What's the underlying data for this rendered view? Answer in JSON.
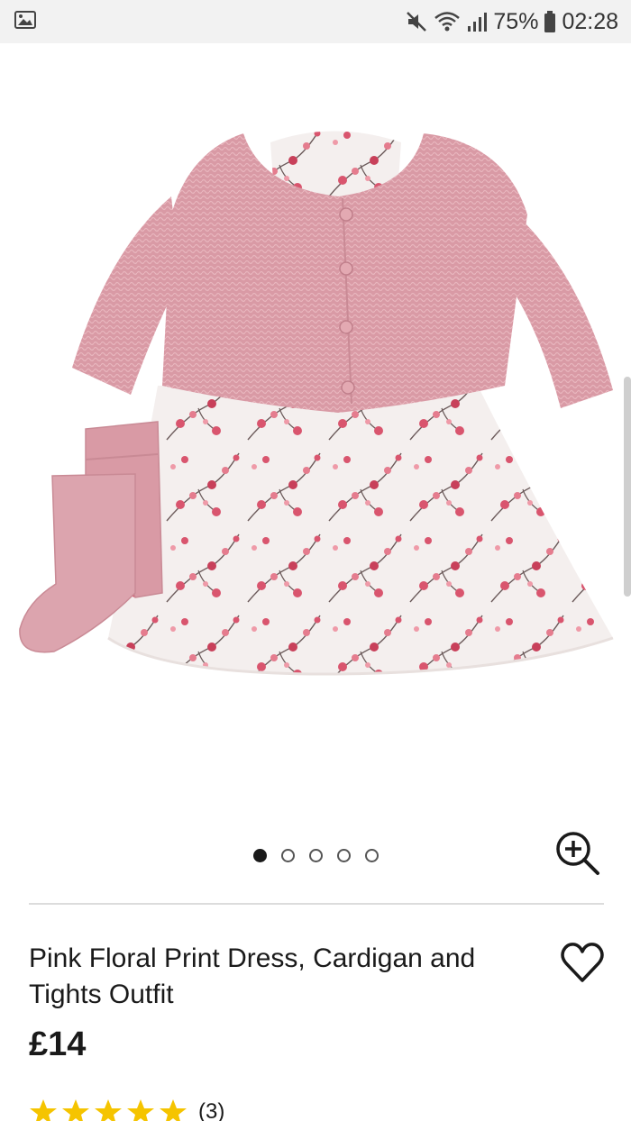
{
  "status_bar": {
    "battery": "75%",
    "time": "02:28",
    "icons": [
      "gallery-icon",
      "mute-icon",
      "wifi-icon",
      "signal-icon",
      "battery-icon"
    ]
  },
  "product": {
    "image_alt": "Pink cardigan, floral print dress and pink tights",
    "carousel": {
      "count": 5,
      "active_index": 0
    },
    "title": "Pink Floral Print Dress, Cardigan and Tights Outfit",
    "price": "£14",
    "rating": {
      "stars": 5,
      "max": 5,
      "count_label": "(3)"
    }
  },
  "colors": {
    "star": "#f5c400",
    "cardigan": "#d99aa5",
    "dress_bg": "#f4efee",
    "blossom": "#d9556e"
  }
}
